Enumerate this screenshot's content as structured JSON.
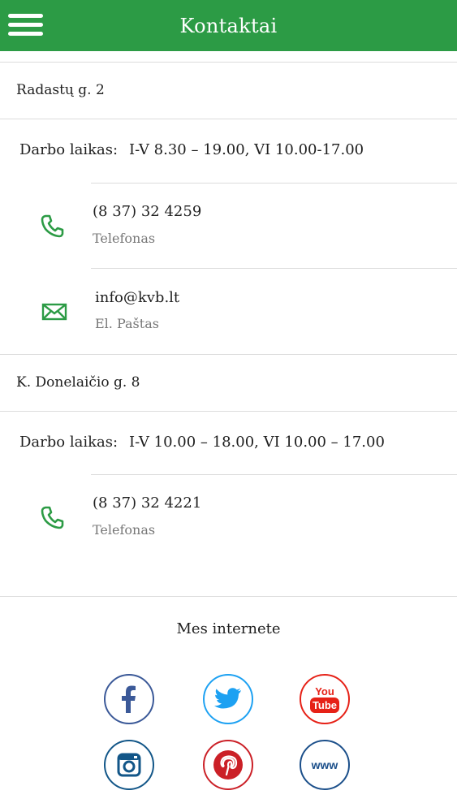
{
  "header": {
    "title": "Kontaktai"
  },
  "locations": [
    {
      "address": "Radastų g. 2",
      "hours_label": "Darbo laikas:",
      "hours": "I-V 8.30 – 19.00, VI 10.00-17.00",
      "phone": "(8 37) 32 4259",
      "phone_label": "Telefonas",
      "email": "info@kvb.lt",
      "email_label": "El. Paštas"
    },
    {
      "address": "K. Donelaičio g. 8",
      "hours_label": "Darbo laikas:",
      "hours": "I-V 10.00 – 18.00, VI 10.00 – 17.00",
      "phone": "(8 37) 32 4221",
      "phone_label": "Telefonas"
    }
  ],
  "social": {
    "title": "Mes internete",
    "items": [
      {
        "name": "facebook",
        "icon": "facebook-icon",
        "color": "#3b5998"
      },
      {
        "name": "twitter",
        "icon": "twitter-icon",
        "color": "#1da1f2"
      },
      {
        "name": "youtube",
        "icon": "youtube-icon",
        "color": "#e62117",
        "text_top": "You",
        "text_bottom": "Tube"
      },
      {
        "name": "instagram",
        "icon": "instagram-icon",
        "color": "#125688"
      },
      {
        "name": "pinterest",
        "icon": "pinterest-icon",
        "color": "#cb2027"
      },
      {
        "name": "website",
        "icon": "www-icon",
        "color": "#1b4f8a",
        "text": "www"
      }
    ]
  },
  "colors": {
    "accent": "#2c9b45",
    "divider": "#dcdcdc",
    "secondary_text": "#777777"
  }
}
